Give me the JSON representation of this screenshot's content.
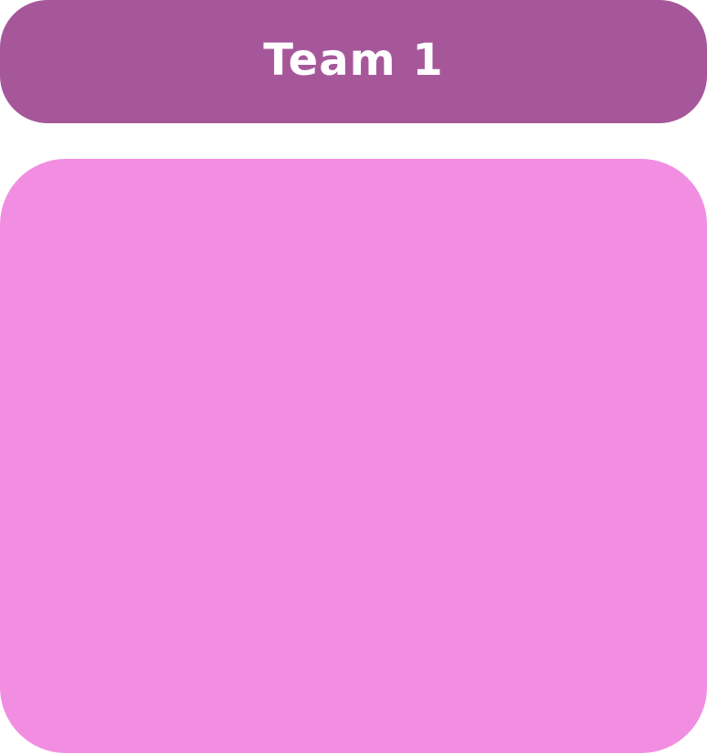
{
  "team": {
    "title": "Team 1"
  },
  "colors": {
    "header_bg": "#a6579a",
    "panel_bg": "#f28ee2",
    "title_text": "#ffffff"
  }
}
